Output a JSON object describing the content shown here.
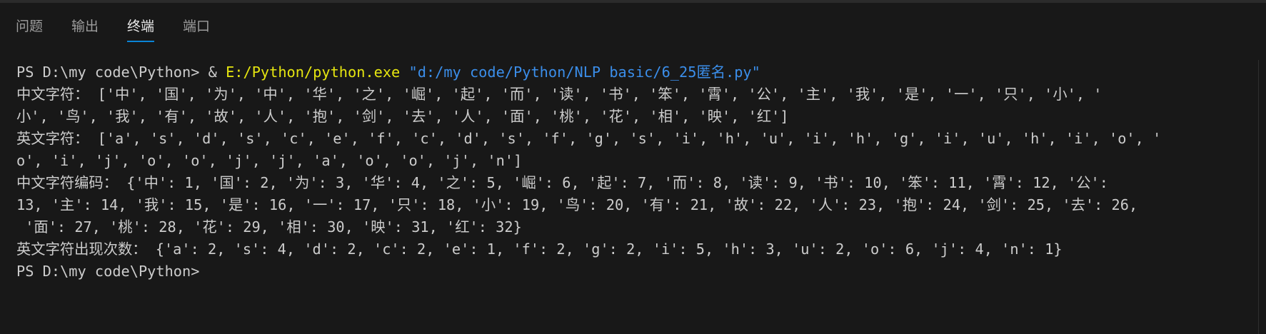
{
  "panel": {
    "tabs": [
      {
        "label": "问题"
      },
      {
        "label": "输出"
      },
      {
        "label": "终端"
      },
      {
        "label": "端口"
      }
    ],
    "active_tab": "终端"
  },
  "terminal": {
    "command_line": {
      "prompt": "PS D:\\my code\\Python> ",
      "amp": "& ",
      "exe": "E:/Python/python.exe",
      "space": " ",
      "arg": "\"d:/my code/Python/NLP basic/6_25匿名.py\""
    },
    "lines": [
      "中文字符： ['中', '国', '为', '中', '华', '之', '崛', '起', '而', '读', '书', '笨', '霄', '公', '主', '我', '是', '一', '只', '小', '",
      "小', '鸟', '我', '有', '故', '人', '抱', '剑', '去', '人', '面', '桃', '花', '相', '映', '红']",
      "英文字符： ['a', 's', 'd', 's', 'c', 'e', 'f', 'c', 'd', 's', 'f', 'g', 's', 'i', 'h', 'u', 'i', 'h', 'g', 'i', 'u', 'h', 'i', 'o', '",
      "o', 'i', 'j', 'o', 'o', 'j', 'j', 'a', 'o', 'o', 'j', 'n']",
      "中文字符编码： {'中': 1, '国': 2, '为': 3, '华': 4, '之': 5, '崛': 6, '起': 7, '而': 8, '读': 9, '书': 10, '笨': 11, '霄': 12, '公':",
      "13, '主': 14, '我': 15, '是': 16, '一': 17, '只': 18, '小': 19, '鸟': 20, '有': 21, '故': 22, '人': 23, '抱': 24, '剑': 25, '去': 26,",
      " '面': 27, '桃': 28, '花': 29, '相': 30, '映': 31, '红': 32}",
      "英文字符出现次数： {'a': 2, 's': 4, 'd': 2, 'c': 2, 'e': 1, 'f': 2, 'g': 2, 'i': 5, 'h': 3, 'u': 2, 'o': 6, 'j': 4, 'n': 1}"
    ],
    "final_prompt": "PS D:\\my code\\Python>"
  },
  "colors": {
    "background": "#181818",
    "text": "#cccccc",
    "command": "#e5e510",
    "string": "#3b8eea",
    "active_tab_underline": "#0a84d6"
  }
}
